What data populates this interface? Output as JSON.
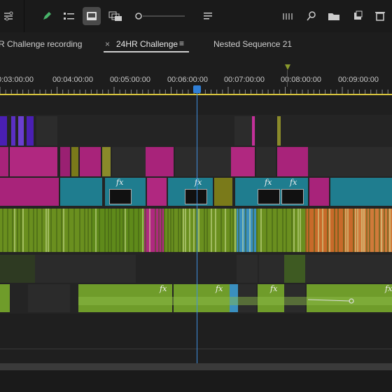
{
  "tabs": [
    {
      "label": "R Challenge recording",
      "active": false
    },
    {
      "label": "24HR Challenge",
      "active": true,
      "close": "×",
      "menu": "≡"
    },
    {
      "label": "Nested Sequence 21",
      "active": false
    }
  ],
  "ruler": {
    "timecodes": [
      "0:03:00:00",
      "00:04:00:00",
      "00:05:00:00",
      "00:06:00:00",
      "00:07:00:00",
      "00:08:00:00",
      "00:09:00:00"
    ]
  },
  "toolbar": {
    "icons": [
      "settings-icon",
      "pen-icon",
      "list-view-icon",
      "single-view-icon",
      "multi-view-icon",
      "zoom-slider",
      "menu-icon",
      "meter-icon",
      "search-icon",
      "folder-icon",
      "new-item-icon",
      "trash-icon"
    ]
  },
  "colors": {
    "playhead": "#3f8fe0",
    "work_area": "#d9c53d",
    "clip_purple": "#4a1fb3",
    "clip_magenta": "#a8237a",
    "clip_teal": "#1f7d8f",
    "clip_green": "#6a8f1f",
    "audio_green": "#6f9c2a",
    "clip_orange": "#c86a2a",
    "clip_blue": "#3a8fbf"
  },
  "clip_labels": {
    "fx": "fx"
  }
}
